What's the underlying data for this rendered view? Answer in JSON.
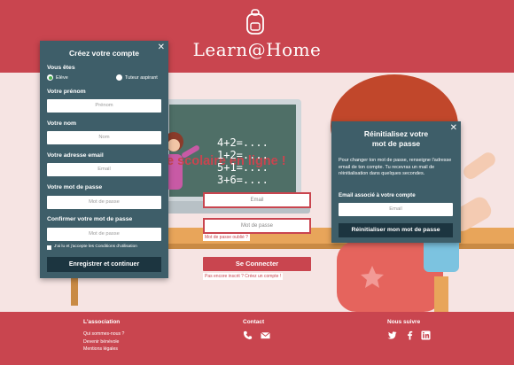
{
  "header": {
    "logo_text": "Learn@Home",
    "logo_icon": "backpack-icon"
  },
  "hero": {
    "title_fragment": "e scolaire en ligne !",
    "board_lines": [
      "4+2=....",
      "1+2=....",
      "5+1=....",
      "3+6=...."
    ]
  },
  "login": {
    "email_placeholder": "Email",
    "password_placeholder": "Mot de passe",
    "forgot_link": "Mot de passe oublié ?",
    "connect_button": "Se Connecter",
    "signup_link": "Pas encore inscrit ? Créez un compte !"
  },
  "signup_panel": {
    "title": "Créez votre compte",
    "close_icon": "close-icon",
    "role_label": "Vous êtes",
    "role_options": [
      "Elève",
      "Tuteur aspirant"
    ],
    "role_selected": "Elève",
    "firstname_label": "Votre prénom",
    "firstname_placeholder": "Prénom",
    "lastname_label": "Votre nom",
    "lastname_placeholder": "Nom",
    "email_label": "Votre adresse email",
    "email_placeholder": "Email",
    "password_label": "Votre mot de passe",
    "password_placeholder": "Mot de passe",
    "confirm_label": "Confirmer votre mot de passe",
    "confirm_placeholder": "Mot de passe",
    "terms_text": "J'ai lu et j'accepte les Conditions d'utilisation",
    "submit_button": "Enregistrer et continuer"
  },
  "reset_panel": {
    "title_line1": "Réinitialisez votre",
    "title_line2": "mot de passe",
    "description": "Pour changer ton mot de passe, renseigne l'adresse email de ton compte. Tu recevras un mail de réinitialisation dans quelques secondes.",
    "email_label": "Email associé à votre compte",
    "email_placeholder": "Email",
    "submit_button": "Réinitialiser mon mot de passe"
  },
  "footer": {
    "association_heading": "L'association",
    "association_links": [
      "Qui sommes-nous ?",
      "Devenir bénévole",
      "Mentions légales"
    ],
    "contact_heading": "Contact",
    "contact_icons": [
      "phone-icon",
      "mail-icon"
    ],
    "social_heading": "Nous suivre",
    "social_icons": [
      "twitter-icon",
      "facebook-icon",
      "linkedin-icon"
    ]
  },
  "colors": {
    "brand": "#c9454f",
    "panel": "#3e5e69",
    "panel_button": "#1c3540",
    "hero_bg": "#f6e4e3"
  }
}
